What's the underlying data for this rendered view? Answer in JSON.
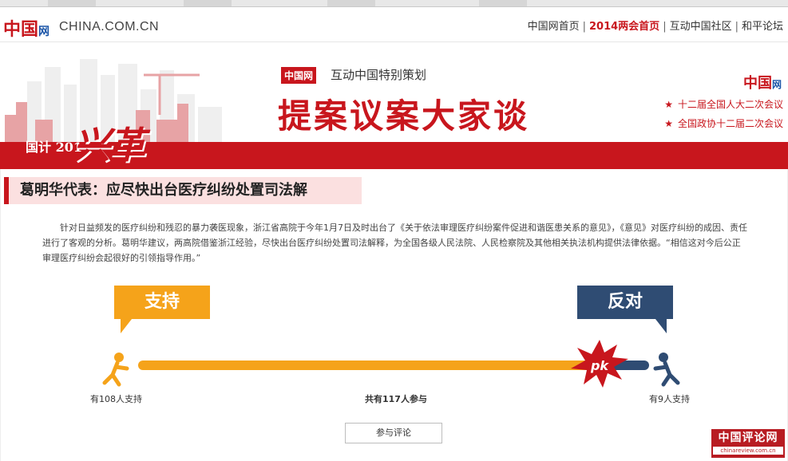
{
  "header": {
    "logo_text": "中国",
    "logo_suffix": "网",
    "domain": "CHINA.COM.CN",
    "nav": [
      {
        "label": "中国网首页",
        "hot": false
      },
      {
        "label": "2014两会首页",
        "hot": true
      },
      {
        "label": "互动中国社区",
        "hot": false
      },
      {
        "label": "和平论坛",
        "hot": false
      }
    ],
    "nav_separator": "|"
  },
  "banner": {
    "badge": "中国网",
    "subtitle": "互动中国特别策划",
    "title": "提案议案大家谈",
    "reform_word": "兴革",
    "reform_small": "国计 2014",
    "right_logo": "中国",
    "right_logo_suffix": "网",
    "sessions": [
      "十二届全国人大二次会议",
      "全国政协十二届二次会议"
    ],
    "star": "★"
  },
  "article": {
    "title": "葛明华代表：应尽快出台医疗纠纷处置司法解",
    "body": "针对日益频发的医疗纠纷和残忍的暴力袭医现象，浙江省高院于今年1月7日及时出台了《关于依法审理医疗纠纷案件促进和谐医患关系的意见》，《意见》对医疗纠纷的成因、责任进行了客观的分析。葛明华建议，两高院借鉴浙江经验，尽快出台医疗纠纷处置司法解释，为全国各级人民法院、人民检察院及其他相关执法机构提供法律依据。“相信这对今后公正审理医疗纠纷会起很好的引领指导作用。”"
  },
  "vote": {
    "support_label": "支持",
    "oppose_label": "反对",
    "pk_label": "pk",
    "support_count": 108,
    "oppose_count": 9,
    "total_count": 117,
    "support_text": "有108人支持",
    "oppose_text": "有9人支持",
    "total_text": "共有117人参与",
    "support_color": "#f5a31a",
    "oppose_color": "#2f4c73",
    "comment_button": "参与评论"
  },
  "footer_badge": {
    "name": "中国评论网",
    "url": "chinareview.com.cn"
  },
  "colors": {
    "brand_red": "#c8161d",
    "title_bg": "#fbe0e0"
  }
}
